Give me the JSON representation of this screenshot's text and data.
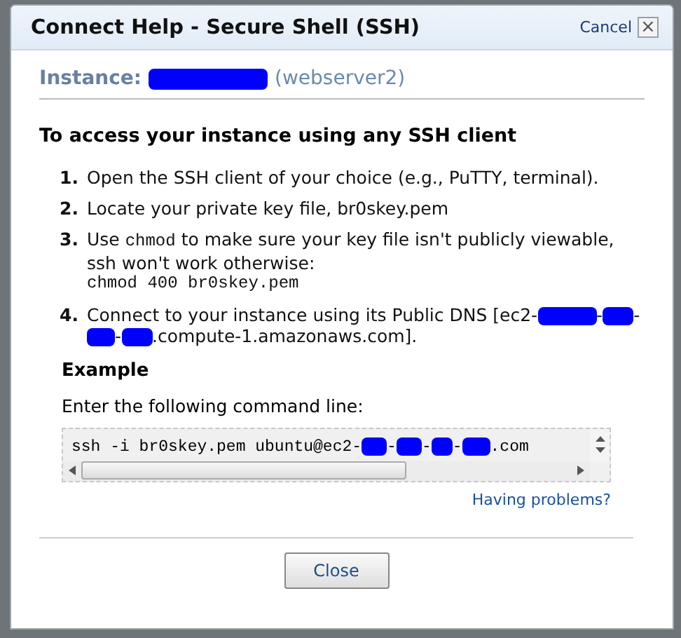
{
  "dialog": {
    "title": "Connect Help - Secure Shell (SSH)",
    "cancel": "Cancel",
    "close_glyph": "×"
  },
  "instance": [
    {
      "kind": "label",
      "text": "Instance:"
    },
    {
      "kind": "redacted"
    },
    {
      "kind": "text",
      "text": "(webserver2)"
    }
  ],
  "heading": "To access your instance using any SSH client",
  "steps": [
    {
      "number": "1.",
      "segments": [
        {
          "kind": "text",
          "text": "Open the SSH client of your choice (e.g., PuTTY, terminal)."
        }
      ]
    },
    {
      "number": "2.",
      "segments": [
        {
          "kind": "text",
          "text": "Locate your private key file, br0skey.pem"
        }
      ]
    },
    {
      "number": "3.",
      "segments": [
        {
          "kind": "text",
          "text": "Use "
        },
        {
          "kind": "code",
          "text": "chmod"
        },
        {
          "kind": "text",
          "text": " to make sure your key file isn't publicly viewable, ssh won't work otherwise:"
        },
        {
          "kind": "codeline",
          "text": "chmod 400 br0skey.pem"
        }
      ]
    },
    {
      "number": "4.",
      "segments": [
        {
          "kind": "text",
          "text": "Connect to your instance using its Public DNS [ec2-"
        },
        {
          "kind": "redacted"
        },
        {
          "kind": "text",
          "text": "-"
        },
        {
          "kind": "redacted"
        },
        {
          "kind": "text",
          "text": "-"
        },
        {
          "kind": "redacted"
        },
        {
          "kind": "text",
          "text": "-"
        },
        {
          "kind": "redacted"
        },
        {
          "kind": "text",
          "text": ".compute-1.amazonaws.com]."
        }
      ]
    }
  ],
  "example": {
    "title": "Example",
    "instruction": "Enter the following command line:",
    "command": [
      {
        "kind": "text",
        "text": "ssh -i br0skey.pem ubuntu@ec2-"
      },
      {
        "kind": "redacted"
      },
      {
        "kind": "text",
        "text": "-"
      },
      {
        "kind": "redacted"
      },
      {
        "kind": "text",
        "text": "-"
      },
      {
        "kind": "redacted"
      },
      {
        "kind": "text",
        "text": "-"
      },
      {
        "kind": "redacted"
      },
      {
        "kind": "text",
        "text": ".com"
      }
    ],
    "help_link": "Having problems?"
  },
  "buttons": [
    "Close"
  ]
}
